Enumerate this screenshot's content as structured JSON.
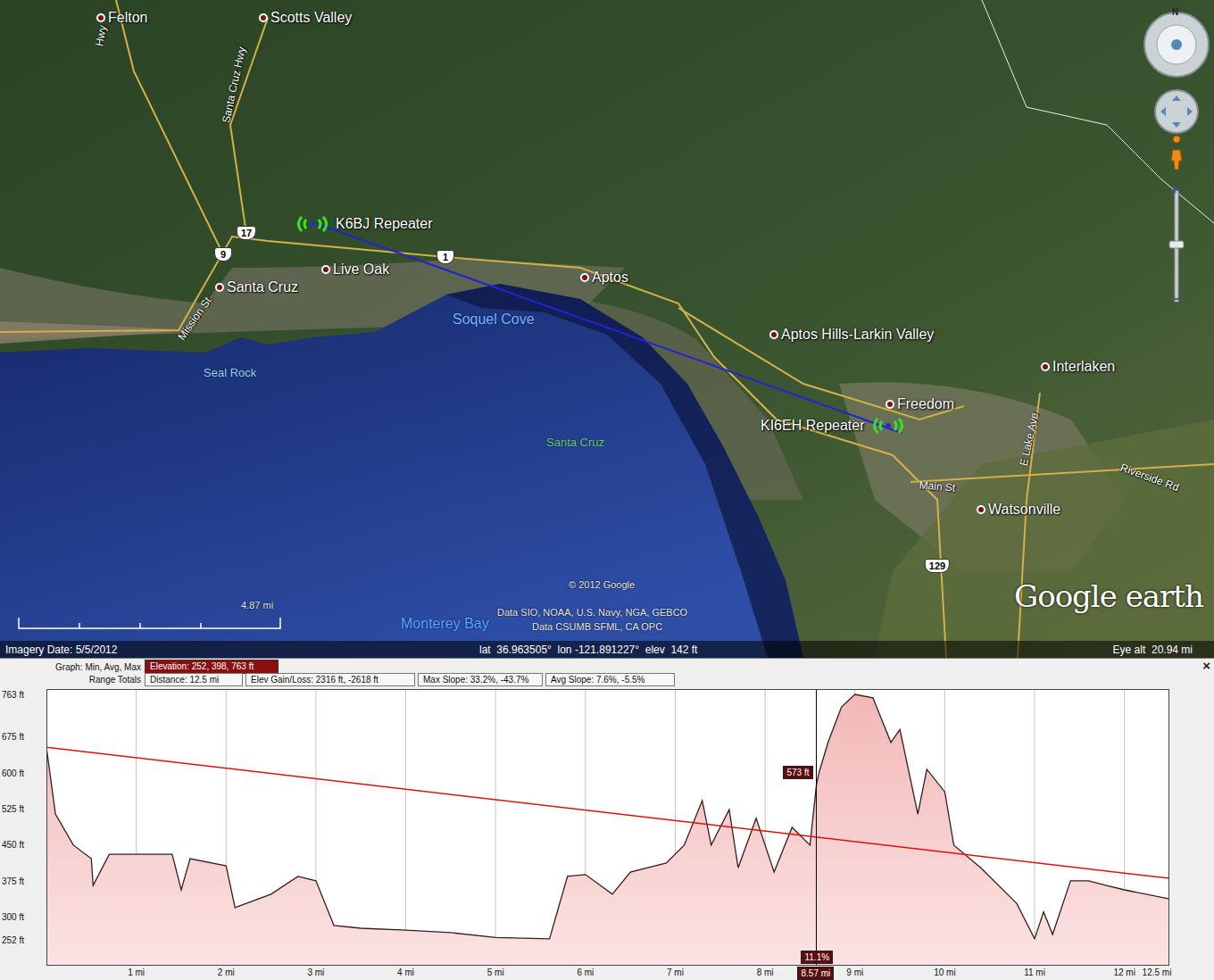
{
  "map": {
    "labels": [
      {
        "text": "Felton",
        "kind": "place"
      },
      {
        "text": "Scotts Valley",
        "kind": "place"
      },
      {
        "text": "Santa Cruz",
        "kind": "place"
      },
      {
        "text": "Live Oak",
        "kind": "place"
      },
      {
        "text": "Aptos",
        "kind": "place"
      },
      {
        "text": "Aptos Hills-Larkin Valley",
        "kind": "place"
      },
      {
        "text": "Interlaken",
        "kind": "place"
      },
      {
        "text": "Freedom",
        "kind": "place"
      },
      {
        "text": "Watsonville",
        "kind": "place"
      },
      {
        "text": "Soquel Cove",
        "kind": "water"
      },
      {
        "text": "Seal Rock",
        "kind": "water"
      },
      {
        "text": "Santa Cruz",
        "kind": "water"
      },
      {
        "text": "Monterey Bay",
        "kind": "water"
      },
      {
        "text": "K6BJ Repeater",
        "kind": "repeater"
      },
      {
        "text": "KI6EH Repeater",
        "kind": "repeater"
      },
      {
        "text": "Hwy",
        "kind": "road"
      },
      {
        "text": "Santa Cruz Hwy",
        "kind": "road"
      },
      {
        "text": "Mission St",
        "kind": "road"
      },
      {
        "text": "Main St",
        "kind": "road"
      },
      {
        "text": "E Lake Ave",
        "kind": "road"
      },
      {
        "text": "Riverside Rd",
        "kind": "road"
      },
      {
        "text": "17",
        "kind": "shield"
      },
      {
        "text": "9",
        "kind": "shield"
      },
      {
        "text": "1",
        "kind": "shield"
      },
      {
        "text": "129",
        "kind": "shield"
      }
    ],
    "nav": {
      "north": "N",
      "zoom_in": "+",
      "zoom_out": "−"
    },
    "scale": "4.87 mi",
    "attribution": [
      "© 2012 Google",
      "Data SIO, NOAA, U.S. Navy, NGA, GEBCO",
      "Data CSUMB SFML, CA OPC"
    ],
    "logo": "Google earth",
    "status": {
      "imagery_date": "Imagery Date: 5/5/2012",
      "position": "lat  36.963505°  lon -121.891227°  elev  142 ft",
      "eye_alt": "Eye alt  20.94 mi"
    }
  },
  "profile": {
    "graph_label": "Graph: Min, Avg, Max",
    "elevation": "Elevation: 252, 398, 763 ft",
    "range_label": "Range Totals",
    "stats": [
      "Distance: 12.5 mi",
      "Elev Gain/Loss: 2316 ft, -2618 ft",
      "Max Slope: 33.2%, -43.7%",
      "Avg Slope: 7.6%, -5.5%"
    ],
    "close": "×",
    "y_ticks": [
      {
        "label": "763 ft",
        "value": 763
      },
      {
        "label": "675 ft",
        "value": 675
      },
      {
        "label": "600 ft",
        "value": 600
      },
      {
        "label": "525 ft",
        "value": 525
      },
      {
        "label": "450 ft",
        "value": 450
      },
      {
        "label": "375 ft",
        "value": 375
      },
      {
        "label": "300 ft",
        "value": 300
      },
      {
        "label": "252 ft",
        "value": 252
      }
    ],
    "x_ticks": [
      {
        "label": "1 mi",
        "value": 1
      },
      {
        "label": "2 mi",
        "value": 2
      },
      {
        "label": "3 mi",
        "value": 3
      },
      {
        "label": "4 mi",
        "value": 4
      },
      {
        "label": "5 mi",
        "value": 5
      },
      {
        "label": "6 mi",
        "value": 6
      },
      {
        "label": "7 mi",
        "value": 7
      },
      {
        "label": "8 mi",
        "value": 8
      },
      {
        "label": "9 mi",
        "value": 9
      },
      {
        "label": "10 mi",
        "value": 10
      },
      {
        "label": "11 mi",
        "value": 11
      },
      {
        "label": "12 mi",
        "value": 12
      },
      {
        "label": "12.5 mi",
        "value": 12.5
      }
    ],
    "series": [
      {
        "name": "elevation",
        "distances": [
          0,
          0.1,
          0.3,
          0.5,
          0.52,
          0.7,
          1,
          1.4,
          1.5,
          1.6,
          2,
          2.1,
          2.5,
          2.8,
          3,
          3.2,
          3.5,
          4,
          4.5,
          5,
          5.6,
          5.8,
          6,
          6.3,
          6.5,
          6.9,
          7.1,
          7.3,
          7.4,
          7.6,
          7.7,
          7.9,
          8.1,
          8.3,
          8.5,
          8.57,
          8.6,
          8.7,
          8.85,
          9,
          9.2,
          9.4,
          9.5,
          9.7,
          9.8,
          10,
          10.1,
          10.4,
          10.8,
          11,
          11.1,
          11.2,
          11.4,
          11.6,
          11.8,
          12,
          12.5
        ],
        "values": [
          653,
          514,
          449,
          421,
          365,
          430,
          430,
          430,
          356,
          421,
          406,
          319,
          347,
          384,
          375,
          282,
          276,
          272,
          267,
          257,
          254,
          384,
          388,
          347,
          393,
          412,
          449,
          542,
          449,
          523,
          402,
          505,
          393,
          486,
          449,
          573,
          600,
          663,
          737,
          763,
          756,
          663,
          690,
          514,
          607,
          560,
          449,
          402,
          328,
          254,
          310,
          263,
          375,
          375,
          365,
          356,
          337
        ]
      },
      {
        "name": "sight line",
        "distances": [
          0,
          12.5
        ],
        "values": [
          653,
          380
        ]
      }
    ],
    "cursor": {
      "distance": 8.57,
      "elevation_label": "573 ft",
      "slope_label": "11.1%",
      "distance_label": "8.57 mi"
    }
  }
}
